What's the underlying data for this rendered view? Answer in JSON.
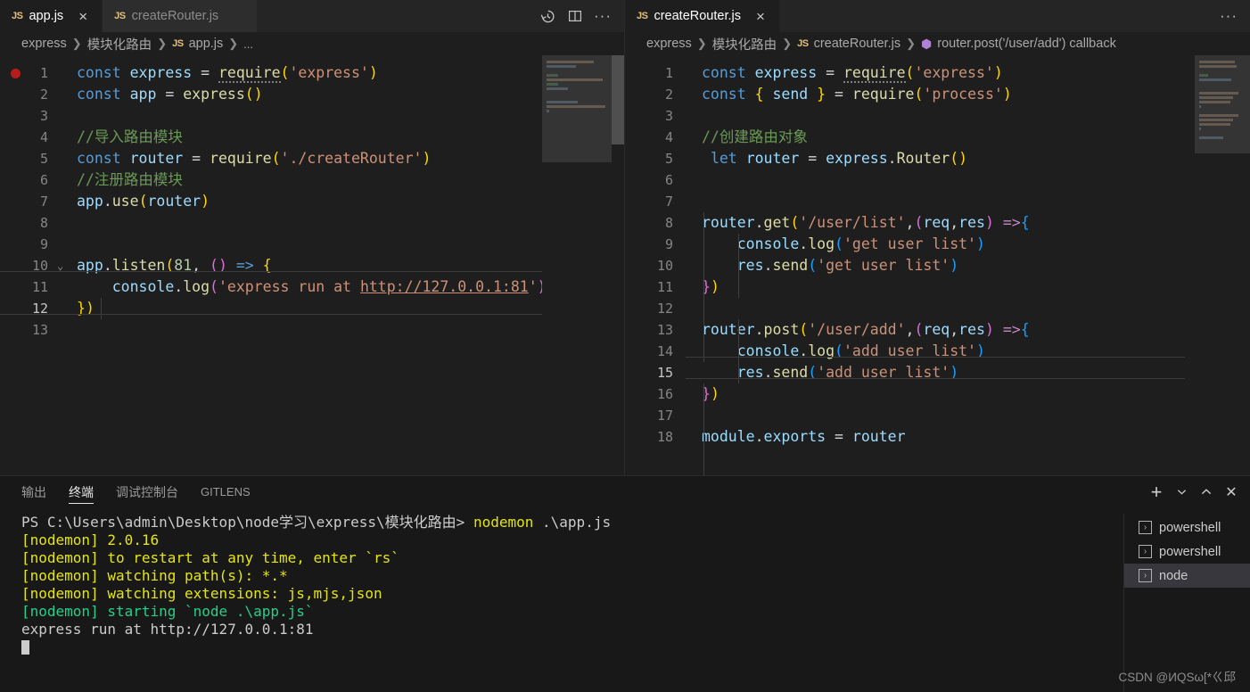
{
  "editor_left": {
    "tabs": [
      {
        "label": "app.js",
        "icon": "js-file-icon",
        "active": true,
        "close": "×"
      },
      {
        "label": "createRouter.js",
        "icon": "js-file-icon",
        "active": false,
        "close": "×"
      }
    ],
    "actions": [
      {
        "name": "timeline-history-icon",
        "glyph": "history"
      },
      {
        "name": "split-editor-icon",
        "glyph": "split"
      },
      {
        "name": "more-actions-icon",
        "glyph": "···"
      }
    ],
    "breadcrumb": [
      {
        "label": "express",
        "icon": null
      },
      {
        "label": "模块化路由",
        "icon": null
      },
      {
        "label": "app.js",
        "icon": "js-file-icon"
      },
      {
        "label": "...",
        "icon": null
      }
    ],
    "current_line": 12,
    "breakpoint_line": 1,
    "fold_line": 10,
    "lines": [
      {
        "n": 1,
        "tokens": [
          {
            "t": "const",
            "c": "kw"
          },
          {
            "t": " ",
            "c": "plain"
          },
          {
            "t": "express",
            "c": "id"
          },
          {
            "t": " = ",
            "c": "plain"
          },
          {
            "t": "require",
            "c": "fn dots"
          },
          {
            "t": "(",
            "c": "p1"
          },
          {
            "t": "'express'",
            "c": "str"
          },
          {
            "t": ")",
            "c": "p1"
          }
        ]
      },
      {
        "n": 2,
        "tokens": [
          {
            "t": "const",
            "c": "kw"
          },
          {
            "t": " ",
            "c": "plain"
          },
          {
            "t": "app",
            "c": "id"
          },
          {
            "t": " = ",
            "c": "plain"
          },
          {
            "t": "express",
            "c": "fn"
          },
          {
            "t": "(",
            "c": "p1"
          },
          {
            "t": ")",
            "c": "p1"
          }
        ]
      },
      {
        "n": 3,
        "tokens": []
      },
      {
        "n": 4,
        "tokens": [
          {
            "t": "//导入路由模块",
            "c": "cmt"
          }
        ]
      },
      {
        "n": 5,
        "tokens": [
          {
            "t": "const",
            "c": "kw"
          },
          {
            "t": " ",
            "c": "plain"
          },
          {
            "t": "router",
            "c": "id"
          },
          {
            "t": " = ",
            "c": "plain"
          },
          {
            "t": "require",
            "c": "fn"
          },
          {
            "t": "(",
            "c": "p1"
          },
          {
            "t": "'./createRouter'",
            "c": "str"
          },
          {
            "t": ")",
            "c": "p1"
          }
        ]
      },
      {
        "n": 6,
        "tokens": [
          {
            "t": "//注册路由模块",
            "c": "cmt"
          }
        ]
      },
      {
        "n": 7,
        "tokens": [
          {
            "t": "app",
            "c": "id"
          },
          {
            "t": ".",
            "c": "plain"
          },
          {
            "t": "use",
            "c": "fn"
          },
          {
            "t": "(",
            "c": "p1"
          },
          {
            "t": "router",
            "c": "id"
          },
          {
            "t": ")",
            "c": "p1"
          }
        ]
      },
      {
        "n": 8,
        "tokens": []
      },
      {
        "n": 9,
        "tokens": []
      },
      {
        "n": 10,
        "tokens": [
          {
            "t": "app",
            "c": "id"
          },
          {
            "t": ".",
            "c": "plain"
          },
          {
            "t": "listen",
            "c": "fn"
          },
          {
            "t": "(",
            "c": "p1"
          },
          {
            "t": "81",
            "c": "num"
          },
          {
            "t": ", ",
            "c": "plain"
          },
          {
            "t": "(",
            "c": "p2"
          },
          {
            "t": ")",
            "c": "p2"
          },
          {
            "t": " ",
            "c": "plain"
          },
          {
            "t": "=>",
            "c": "kw"
          },
          {
            "t": " ",
            "c": "plain"
          },
          {
            "t": "{",
            "c": "p1"
          }
        ]
      },
      {
        "n": 11,
        "tokens": [
          {
            "t": "    ",
            "c": "plain"
          },
          {
            "t": "console",
            "c": "id"
          },
          {
            "t": ".",
            "c": "plain"
          },
          {
            "t": "log",
            "c": "fn"
          },
          {
            "t": "(",
            "c": "p2"
          },
          {
            "t": "'express run at ",
            "c": "str"
          },
          {
            "t": "http://127.0.0.1:81",
            "c": "link"
          },
          {
            "t": "'",
            "c": "str"
          },
          {
            "t": ")",
            "c": "p2"
          }
        ]
      },
      {
        "n": 12,
        "tokens": [
          {
            "t": "}",
            "c": "p1"
          },
          {
            "t": ")",
            "c": "p1"
          }
        ]
      },
      {
        "n": 13,
        "tokens": []
      }
    ]
  },
  "editor_right": {
    "tabs": [
      {
        "label": "createRouter.js",
        "icon": "js-file-icon",
        "active": true,
        "close": "×"
      }
    ],
    "actions": [
      {
        "name": "more-actions-icon",
        "glyph": "···"
      }
    ],
    "breadcrumb": [
      {
        "label": "express",
        "icon": null
      },
      {
        "label": "模块化路由",
        "icon": null
      },
      {
        "label": "createRouter.js",
        "icon": "js-file-icon"
      },
      {
        "label": "router.post('/user/add') callback",
        "icon": "symbol-cube-icon"
      }
    ],
    "current_line": 15,
    "lines": [
      {
        "n": 1,
        "tokens": [
          {
            "t": "const",
            "c": "kw"
          },
          {
            "t": " ",
            "c": "plain"
          },
          {
            "t": "express",
            "c": "id"
          },
          {
            "t": " = ",
            "c": "plain"
          },
          {
            "t": "require",
            "c": "fn dots"
          },
          {
            "t": "(",
            "c": "p1"
          },
          {
            "t": "'express'",
            "c": "str"
          },
          {
            "t": ")",
            "c": "p1"
          }
        ]
      },
      {
        "n": 2,
        "tokens": [
          {
            "t": "const",
            "c": "kw"
          },
          {
            "t": " ",
            "c": "plain"
          },
          {
            "t": "{",
            "c": "p1"
          },
          {
            "t": " ",
            "c": "plain"
          },
          {
            "t": "send",
            "c": "id"
          },
          {
            "t": " ",
            "c": "plain"
          },
          {
            "t": "}",
            "c": "p1"
          },
          {
            "t": " = ",
            "c": "plain"
          },
          {
            "t": "require",
            "c": "fn"
          },
          {
            "t": "(",
            "c": "p1"
          },
          {
            "t": "'process'",
            "c": "str"
          },
          {
            "t": ")",
            "c": "p1"
          }
        ]
      },
      {
        "n": 3,
        "tokens": []
      },
      {
        "n": 4,
        "tokens": [
          {
            "t": "//创建路由对象",
            "c": "cmt"
          }
        ]
      },
      {
        "n": 5,
        "tokens": [
          {
            "t": " ",
            "c": "plain"
          },
          {
            "t": "let",
            "c": "kw"
          },
          {
            "t": " ",
            "c": "plain"
          },
          {
            "t": "router",
            "c": "id"
          },
          {
            "t": " = ",
            "c": "plain"
          },
          {
            "t": "express",
            "c": "id"
          },
          {
            "t": ".",
            "c": "plain"
          },
          {
            "t": "Router",
            "c": "fn"
          },
          {
            "t": "(",
            "c": "p1"
          },
          {
            "t": ")",
            "c": "p1"
          }
        ]
      },
      {
        "n": 6,
        "tokens": []
      },
      {
        "n": 7,
        "tokens": []
      },
      {
        "n": 8,
        "tokens": [
          {
            "t": "router",
            "c": "id"
          },
          {
            "t": ".",
            "c": "plain"
          },
          {
            "t": "get",
            "c": "fn"
          },
          {
            "t": "(",
            "c": "p1"
          },
          {
            "t": "'/user/list'",
            "c": "str"
          },
          {
            "t": ",",
            "c": "plain"
          },
          {
            "t": "(",
            "c": "p2"
          },
          {
            "t": "req",
            "c": "id"
          },
          {
            "t": ",",
            "c": "plain"
          },
          {
            "t": "res",
            "c": "id"
          },
          {
            "t": ")",
            "c": "p2"
          },
          {
            "t": " ",
            "c": "plain"
          },
          {
            "t": "=>",
            "c": "kw2"
          },
          {
            "t": "{",
            "c": "p3"
          }
        ]
      },
      {
        "n": 9,
        "tokens": [
          {
            "t": "    ",
            "c": "plain"
          },
          {
            "t": "console",
            "c": "id"
          },
          {
            "t": ".",
            "c": "plain"
          },
          {
            "t": "log",
            "c": "fn"
          },
          {
            "t": "(",
            "c": "p3"
          },
          {
            "t": "'get user list'",
            "c": "str"
          },
          {
            "t": ")",
            "c": "p3"
          }
        ]
      },
      {
        "n": 10,
        "tokens": [
          {
            "t": "    ",
            "c": "plain"
          },
          {
            "t": "res",
            "c": "id"
          },
          {
            "t": ".",
            "c": "plain"
          },
          {
            "t": "send",
            "c": "fn"
          },
          {
            "t": "(",
            "c": "p3"
          },
          {
            "t": "'get user list'",
            "c": "str"
          },
          {
            "t": ")",
            "c": "p3"
          }
        ]
      },
      {
        "n": 11,
        "tokens": [
          {
            "t": "}",
            "c": "p2"
          },
          {
            "t": ")",
            "c": "p1"
          }
        ]
      },
      {
        "n": 12,
        "tokens": []
      },
      {
        "n": 13,
        "tokens": [
          {
            "t": "router",
            "c": "id"
          },
          {
            "t": ".",
            "c": "plain"
          },
          {
            "t": "post",
            "c": "fn"
          },
          {
            "t": "(",
            "c": "p1"
          },
          {
            "t": "'/user/add'",
            "c": "str"
          },
          {
            "t": ",",
            "c": "plain"
          },
          {
            "t": "(",
            "c": "p2"
          },
          {
            "t": "req",
            "c": "id"
          },
          {
            "t": ",",
            "c": "plain"
          },
          {
            "t": "res",
            "c": "id"
          },
          {
            "t": ")",
            "c": "p2"
          },
          {
            "t": " ",
            "c": "plain"
          },
          {
            "t": "=>",
            "c": "kw2"
          },
          {
            "t": "{",
            "c": "p3"
          }
        ]
      },
      {
        "n": 14,
        "tokens": [
          {
            "t": "    ",
            "c": "plain"
          },
          {
            "t": "console",
            "c": "id"
          },
          {
            "t": ".",
            "c": "plain"
          },
          {
            "t": "log",
            "c": "fn"
          },
          {
            "t": "(",
            "c": "p3"
          },
          {
            "t": "'add user list'",
            "c": "str"
          },
          {
            "t": ")",
            "c": "p3"
          }
        ]
      },
      {
        "n": 15,
        "tokens": [
          {
            "t": "    ",
            "c": "plain"
          },
          {
            "t": "res",
            "c": "id"
          },
          {
            "t": ".",
            "c": "plain"
          },
          {
            "t": "send",
            "c": "fn"
          },
          {
            "t": "(",
            "c": "p3"
          },
          {
            "t": "'add user list'",
            "c": "str"
          },
          {
            "t": ")",
            "c": "p3"
          }
        ]
      },
      {
        "n": 16,
        "tokens": [
          {
            "t": "}",
            "c": "p2"
          },
          {
            "t": ")",
            "c": "p1"
          }
        ]
      },
      {
        "n": 17,
        "tokens": []
      },
      {
        "n": 18,
        "tokens": [
          {
            "t": "module",
            "c": "id"
          },
          {
            "t": ".",
            "c": "plain"
          },
          {
            "t": "exports",
            "c": "id"
          },
          {
            "t": " = ",
            "c": "plain"
          },
          {
            "t": "router",
            "c": "id"
          }
        ]
      }
    ]
  },
  "panel": {
    "tabs": [
      {
        "label": "输出",
        "active": false
      },
      {
        "label": "终端",
        "active": true
      },
      {
        "label": "调试控制台",
        "active": false
      },
      {
        "label": "GITLENS",
        "active": false
      }
    ],
    "actions": [
      {
        "name": "new-terminal-icon",
        "glyph": "+"
      },
      {
        "name": "chevron-down-icon",
        "glyph": "⌄"
      },
      {
        "name": "maximize-panel-icon",
        "glyph": "^"
      },
      {
        "name": "close-panel-icon",
        "glyph": "✕"
      }
    ],
    "terminal_lines": [
      {
        "segs": [
          {
            "t": "PS C:\\Users\\admin\\Desktop\\node学习\\express\\模块化路由> ",
            "c": "t-white"
          },
          {
            "t": "nodemon",
            "c": "t-yellow2"
          },
          {
            "t": " .\\app.js",
            "c": "t-white"
          }
        ]
      },
      {
        "segs": [
          {
            "t": "[nodemon] 2.0.16",
            "c": "t-yellow2"
          }
        ]
      },
      {
        "segs": [
          {
            "t": "[nodemon] to restart at any time, enter `rs`",
            "c": "t-yellow2"
          }
        ]
      },
      {
        "segs": [
          {
            "t": "[nodemon] watching path(s): *.*",
            "c": "t-yellow2"
          }
        ]
      },
      {
        "segs": [
          {
            "t": "[nodemon] watching extensions: js,mjs,json",
            "c": "t-yellow2"
          }
        ]
      },
      {
        "segs": [
          {
            "t": "[nodemon] starting `node .\\app.js`",
            "c": "t-green"
          }
        ]
      },
      {
        "segs": [
          {
            "t": "express run at http://127.0.0.1:81",
            "c": "t-white"
          }
        ]
      }
    ],
    "terminal_list": [
      {
        "label": "powershell",
        "icon": "terminal-prompt-icon",
        "selected": false
      },
      {
        "label": "powershell",
        "icon": "terminal-prompt-icon",
        "selected": false
      },
      {
        "label": "node",
        "icon": "terminal-prompt-icon",
        "selected": true
      }
    ]
  },
  "watermark": {
    "text": "CSDN @ИQSω[*ㄍ邱"
  },
  "colors": {
    "editor_bg": "#1e1e1e",
    "tabbar_bg": "#252526",
    "inactive_tab_bg": "#2d2d2d",
    "panel_bg": "#181818",
    "selection_bg": "#37373d",
    "keyword": "#569cd6",
    "function": "#dcdcaa",
    "string": "#ce9178",
    "comment": "#6a9955",
    "number": "#b5cea8",
    "variable": "#9cdcfe",
    "breakpoint": "#b71c1c",
    "terminal_yellow": "#e5e510",
    "terminal_green": "#23d18b"
  }
}
